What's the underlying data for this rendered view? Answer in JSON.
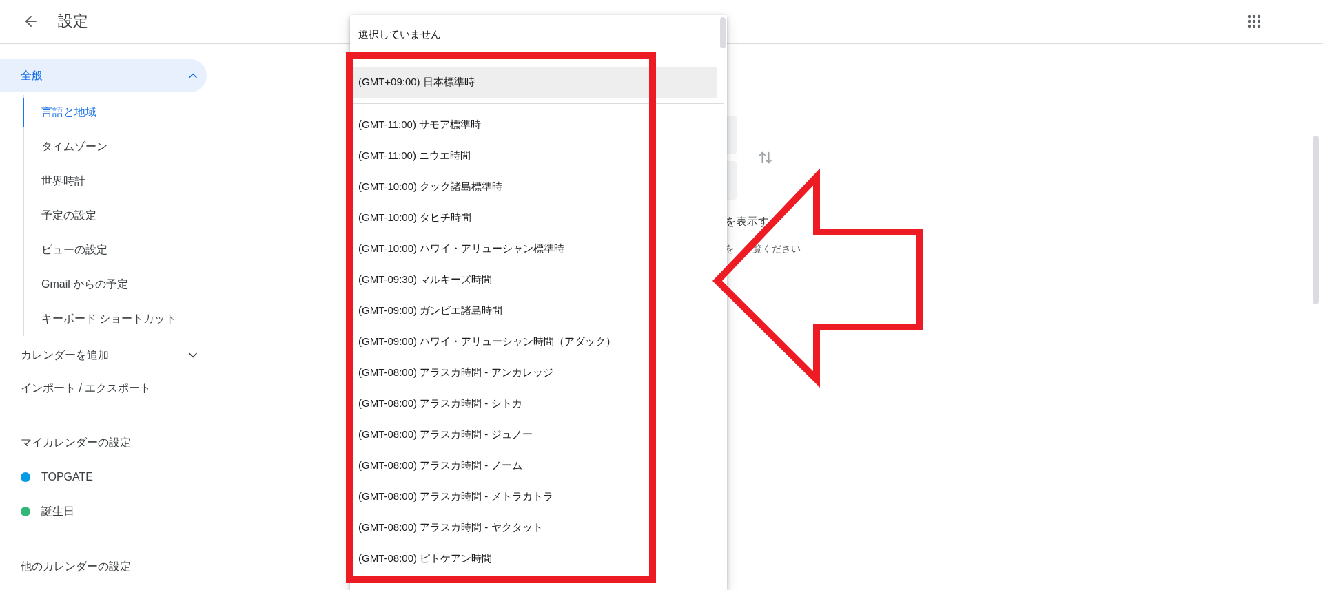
{
  "header": {
    "title": "設定"
  },
  "sidebar": {
    "sections": [
      {
        "label": "全般",
        "selected": true,
        "expanded": true,
        "children": [
          {
            "label": "言語と地域",
            "selected": true
          },
          {
            "label": "タイムゾーン",
            "selected": false
          },
          {
            "label": "世界時計",
            "selected": false
          },
          {
            "label": "予定の設定",
            "selected": false
          },
          {
            "label": "ビューの設定",
            "selected": false
          },
          {
            "label": "Gmail からの予定",
            "selected": false
          },
          {
            "label": "キーボード ショートカット",
            "selected": false
          }
        ]
      },
      {
        "label": "カレンダーを追加",
        "selected": false,
        "expanded": false
      },
      {
        "label": "インポート / エクスポート",
        "selected": false
      }
    ],
    "my_calendars": {
      "title": "マイカレンダーの設定",
      "items": [
        {
          "label": "TOPGATE",
          "color": "#039be5"
        },
        {
          "label": "誕生日",
          "color": "#33b679"
        }
      ]
    },
    "other_calendars": {
      "title": "他のカレンダーの設定"
    }
  },
  "main": {
    "notes": [
      {
        "parts": [
          "を表示す"
        ]
      },
      {
        "parts": [
          "を",
          "覧ください"
        ]
      }
    ]
  },
  "timezone_menu": {
    "groups": [
      {
        "options": [
          {
            "label": "選択していません",
            "selected": false
          }
        ]
      },
      {
        "options": [
          {
            "label": "(GMT+09:00) 日本標準時",
            "selected": true
          }
        ]
      },
      {
        "options": [
          {
            "label": "(GMT-11:00) サモア標準時",
            "selected": false
          },
          {
            "label": "(GMT-11:00) ニウエ時間",
            "selected": false
          },
          {
            "label": "(GMT-10:00) クック諸島標準時",
            "selected": false
          },
          {
            "label": "(GMT-10:00) タヒチ時間",
            "selected": false
          },
          {
            "label": "(GMT-10:00) ハワイ・アリューシャン標準時",
            "selected": false
          },
          {
            "label": "(GMT-09:30) マルキーズ時間",
            "selected": false
          },
          {
            "label": "(GMT-09:00) ガンビエ諸島時間",
            "selected": false
          },
          {
            "label": "(GMT-09:00) ハワイ・アリューシャン時間（アダック）",
            "selected": false
          },
          {
            "label": "(GMT-08:00) アラスカ時間 - アンカレッジ",
            "selected": false
          },
          {
            "label": "(GMT-08:00) アラスカ時間 - シトカ",
            "selected": false
          },
          {
            "label": "(GMT-08:00) アラスカ時間 - ジュノー",
            "selected": false
          },
          {
            "label": "(GMT-08:00) アラスカ時間 - ノーム",
            "selected": false
          },
          {
            "label": "(GMT-08:00) アラスカ時間 - メトラカトラ",
            "selected": false
          },
          {
            "label": "(GMT-08:00) アラスカ時間 - ヤクタット",
            "selected": false
          },
          {
            "label": "(GMT-08:00) ピトケアン時間",
            "selected": false
          }
        ]
      }
    ]
  }
}
